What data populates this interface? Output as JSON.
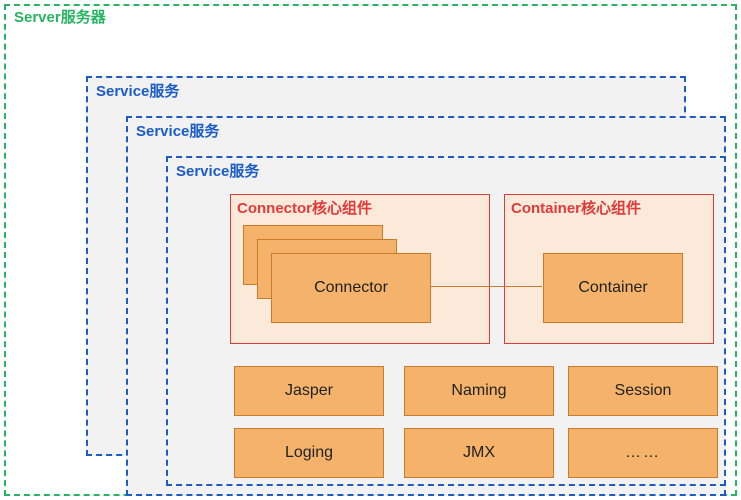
{
  "server": {
    "label": "Server服务器"
  },
  "services": {
    "label": "Service服务"
  },
  "cores": {
    "connector": {
      "title": "Connector核心组件",
      "block": "Connector"
    },
    "container": {
      "title": "Container核心组件",
      "block": "Container"
    }
  },
  "subs": {
    "jasper": "Jasper",
    "naming": "Naming",
    "session": "Session",
    "loging": "Loging",
    "jmx": "JMX",
    "more": "……"
  }
}
